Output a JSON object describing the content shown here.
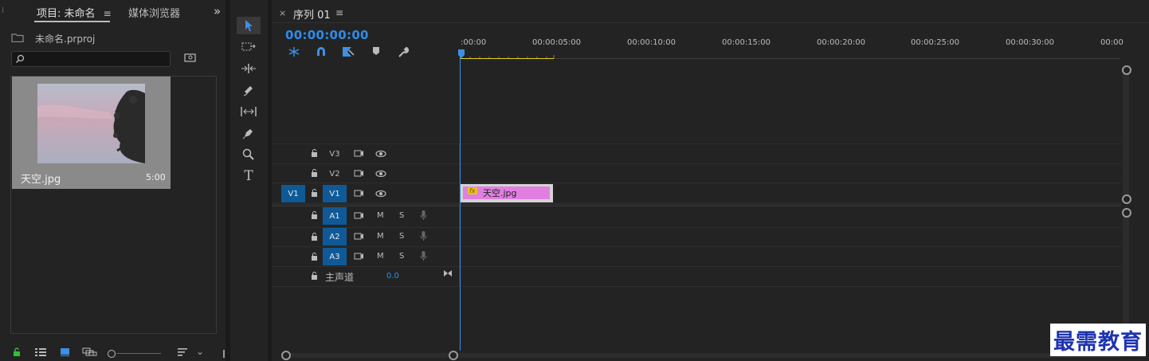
{
  "project_panel": {
    "tabs": [
      {
        "label": "项目: 未命名",
        "menu": "≡"
      },
      {
        "label": "媒体浏览器"
      }
    ],
    "overflow": "»",
    "project_file": "未命名.prproj",
    "search_placeholder": "",
    "clip_item": {
      "name": "天空.jpg",
      "duration": "5:00"
    }
  },
  "sequence_panel": {
    "close": "×",
    "tab_label": "序列 01",
    "menu": "≡",
    "timecode": "00:00:00:00",
    "ruler_labels": [
      ":00:00",
      "00:00:05:00",
      "00:00:10:00",
      "00:00:15:00",
      "00:00:20:00",
      "00:00:25:00",
      "00:00:30:00",
      "00:00"
    ],
    "video_tracks": [
      {
        "name": "V3",
        "source": ""
      },
      {
        "name": "V2",
        "source": ""
      },
      {
        "name": "V1",
        "source": "V1"
      }
    ],
    "audio_tracks": [
      {
        "name": "A1",
        "m": "M",
        "s": "S"
      },
      {
        "name": "A2",
        "m": "M",
        "s": "S"
      },
      {
        "name": "A3",
        "m": "M",
        "s": "S"
      }
    ],
    "master": {
      "label": "主声道",
      "value": "0.0"
    },
    "clip": {
      "fx": "fx",
      "name": "天空.jpg"
    }
  },
  "watermark": "最需教育",
  "colors": {
    "accent": "#2d8ceb",
    "track_blue": "#0f5a96",
    "clip_pink": "#e07fe0",
    "work_area": "#e8d21d"
  }
}
